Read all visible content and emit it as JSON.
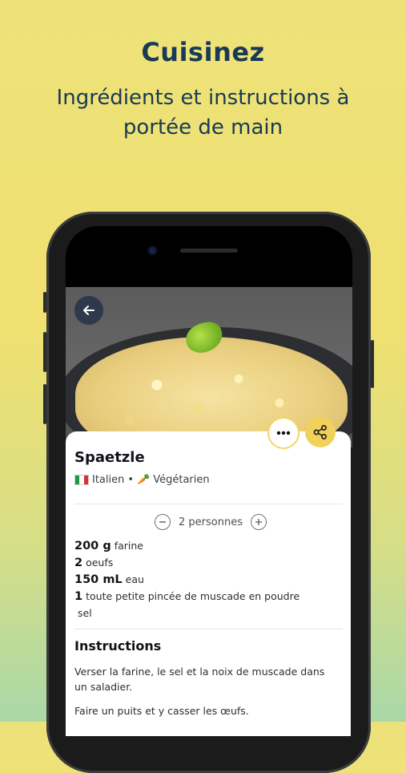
{
  "promo": {
    "headline": "Cuisinez",
    "subline": "Ingrédients et instructions à portée de main"
  },
  "recipe": {
    "title": "Spaetzle",
    "cuisine": "Italien",
    "separator": "•",
    "diet_emoji": "🥕",
    "diet": "Végétarien",
    "servings": "2 personnes",
    "ingredients": [
      {
        "qty": "200 g",
        "name": "farine"
      },
      {
        "qty": "2",
        "name": "oeufs"
      },
      {
        "qty": "150 mL",
        "name": "eau"
      },
      {
        "qty": "1",
        "name": "toute petite pincée de muscade en poudre"
      },
      {
        "qty": "",
        "name": "sel"
      }
    ],
    "instructions_title": "Instructions",
    "steps": [
      "Verser la farine, le sel et la noix de muscade dans un saladier.",
      "Faire un puits et y casser les œufs."
    ]
  },
  "colors": {
    "headline": "#183a54",
    "accent_yellow": "#f2d15a",
    "flag_green": "#1a9b4b",
    "flag_red": "#d8322e"
  },
  "icons": {
    "back": "arrow-left-icon",
    "more": "ellipsis-icon",
    "share": "share-icon",
    "minus": "minus-circle-icon",
    "plus": "plus-circle-icon",
    "flag": "italy-flag-icon"
  }
}
